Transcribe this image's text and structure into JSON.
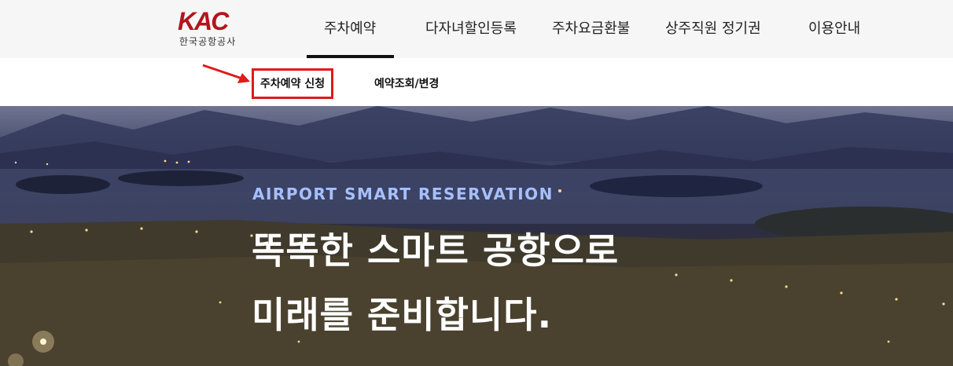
{
  "brand": {
    "logo_text": "KAC",
    "logo_sub": "한국공항공사",
    "logo_color": "#b3141c"
  },
  "gnb": {
    "items": [
      "주차예약",
      "다자녀할인등록",
      "주차요금환불",
      "상주직원 정기권",
      "이용안내"
    ],
    "active_index": 0
  },
  "subnav": {
    "items": [
      "주차예약 신청",
      "예약조회/변경"
    ],
    "highlight_color": "#e0191b"
  },
  "hero": {
    "eyebrow": "AIRPORT SMART RESERVATION",
    "line1": "똑똑한 스마트 공항으로",
    "line2": "미래를 준비합니다."
  }
}
